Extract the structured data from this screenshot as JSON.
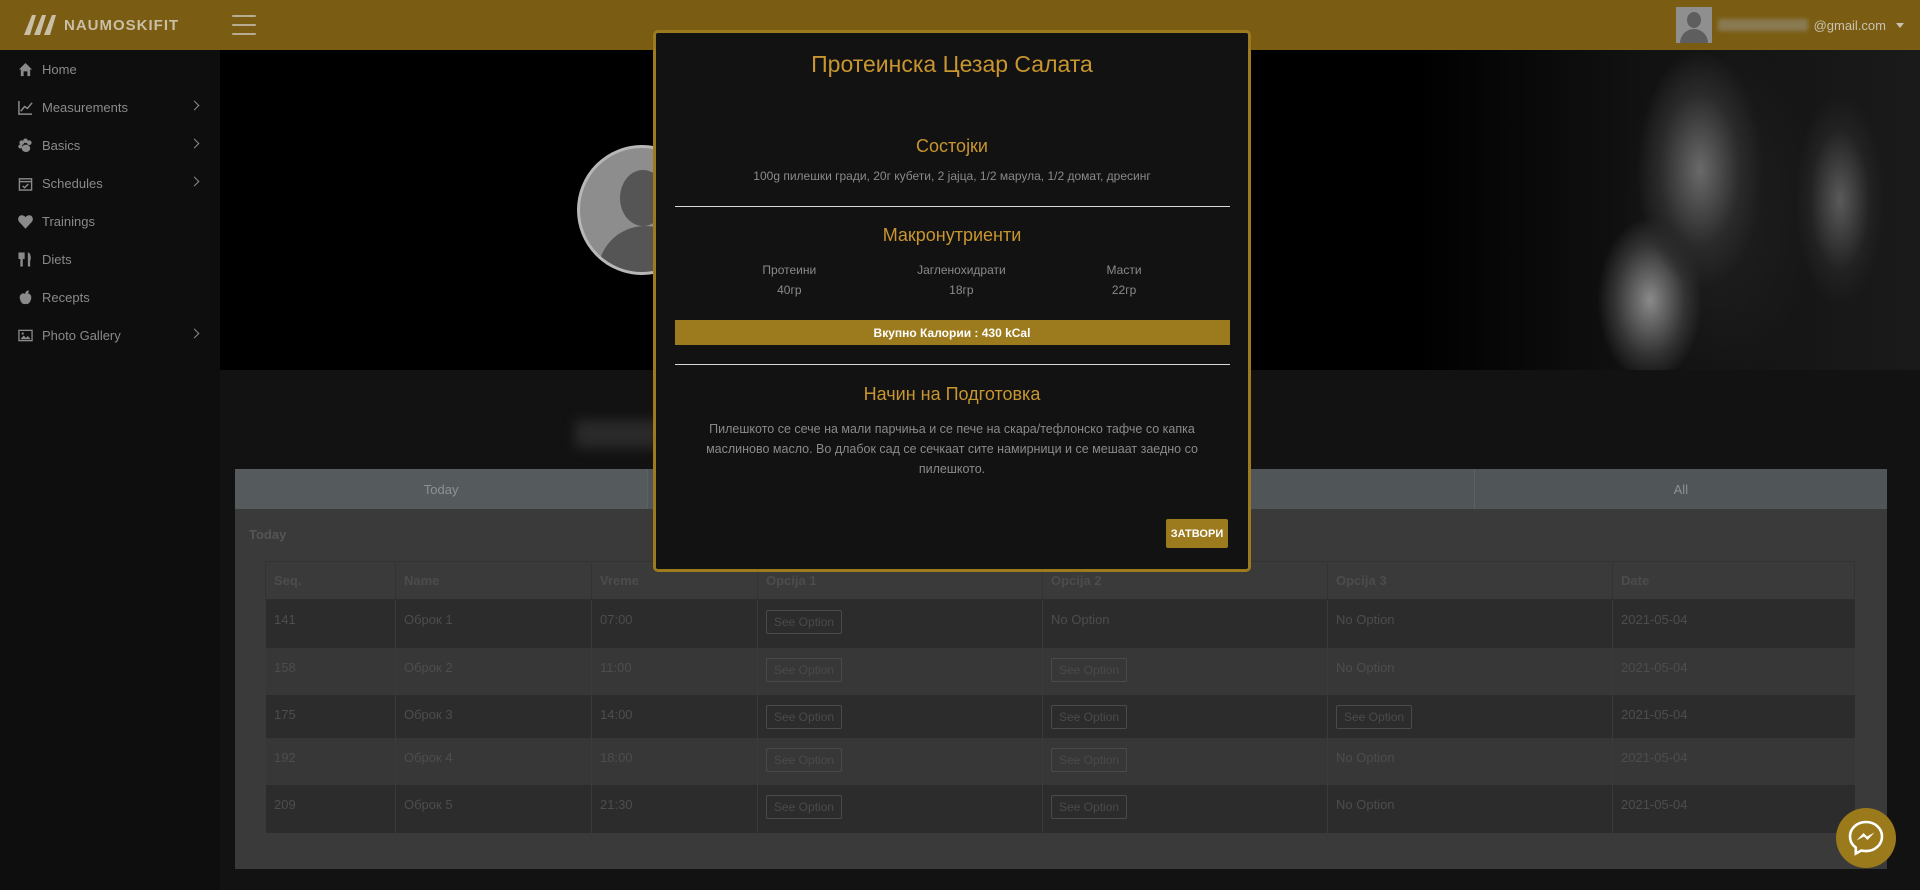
{
  "brand": {
    "name": "NAUMOSKIFIT"
  },
  "user": {
    "email_suffix": "@gmail.com"
  },
  "sidebar": {
    "items": [
      {
        "label": "Home",
        "icon": "home-icon",
        "has_submenu": false
      },
      {
        "label": "Measurements",
        "icon": "chart-line-icon",
        "has_submenu": true
      },
      {
        "label": "Basics",
        "icon": "paw-icon",
        "has_submenu": true
      },
      {
        "label": "Schedules",
        "icon": "calendar-check-icon",
        "has_submenu": true
      },
      {
        "label": "Trainings",
        "icon": "heartbeat-icon",
        "has_submenu": false
      },
      {
        "label": "Diets",
        "icon": "utensils-icon",
        "has_submenu": false
      },
      {
        "label": "Recepts",
        "icon": "apple-icon",
        "has_submenu": false
      },
      {
        "label": "Photo Gallery",
        "icon": "image-icon",
        "has_submenu": true
      }
    ]
  },
  "tabs": [
    "Today",
    "",
    "",
    "All"
  ],
  "panel": {
    "heading": "Today"
  },
  "table": {
    "columns": [
      "Seq.",
      "Name",
      "Vreme",
      "Opcija 1",
      "Opcija 2",
      "Opcija 3",
      "Date"
    ],
    "see_option_label": "See Option",
    "no_option_label": "No Option",
    "rows": [
      {
        "seq": "141",
        "name": "Оброк 1",
        "time": "07:00",
        "opt1": "See Option",
        "opt2": "No Option",
        "opt3": "No Option",
        "date": "2021-05-04"
      },
      {
        "seq": "158",
        "name": "Оброк 2",
        "time": "11:00",
        "opt1": "See Option",
        "opt2": "See Option",
        "opt3": "No Option",
        "date": "2021-05-04"
      },
      {
        "seq": "175",
        "name": "Оброк 3",
        "time": "14:00",
        "opt1": "See Option",
        "opt2": "See Option",
        "opt3": "See Option",
        "date": "2021-05-04"
      },
      {
        "seq": "192",
        "name": "Оброк 4",
        "time": "18:00",
        "opt1": "See Option",
        "opt2": "See Option",
        "opt3": "No Option",
        "date": "2021-05-04"
      },
      {
        "seq": "209",
        "name": "Оброк 5",
        "time": "21:30",
        "opt1": "See Option",
        "opt2": "See Option",
        "opt3": "No Option",
        "date": "2021-05-04"
      }
    ]
  },
  "modal": {
    "title": "Протеинска Цезар Салата",
    "ingredients_title": "Состојки",
    "ingredients": "100g пилешки гради, 20г кубети, 2 јајца, 1/2 марула, 1/2 домат, дресинг",
    "macros_title": "Макронутриенти",
    "macros": [
      {
        "label": "Протеини",
        "value": "40гр"
      },
      {
        "label": "Јагленохидрати",
        "value": "18гр"
      },
      {
        "label": "Масти",
        "value": "22гр"
      }
    ],
    "calories": "Вкупно Калории : 430 kCal",
    "prep_title": "Начин на Подготовка",
    "prep_text": "Пилешкото се сече на мали парчиња и се пече на скара/тефлонско тафче со капка маслиново масло. Во длабок сад се сечкаат сите намирници и се мешаат заедно со пилешкото.",
    "close_label": "ЗАТВОРИ"
  },
  "colors": {
    "accent": "#9c7a1e",
    "title_gold": "#c8952e",
    "topbar": "#7a5d12"
  }
}
